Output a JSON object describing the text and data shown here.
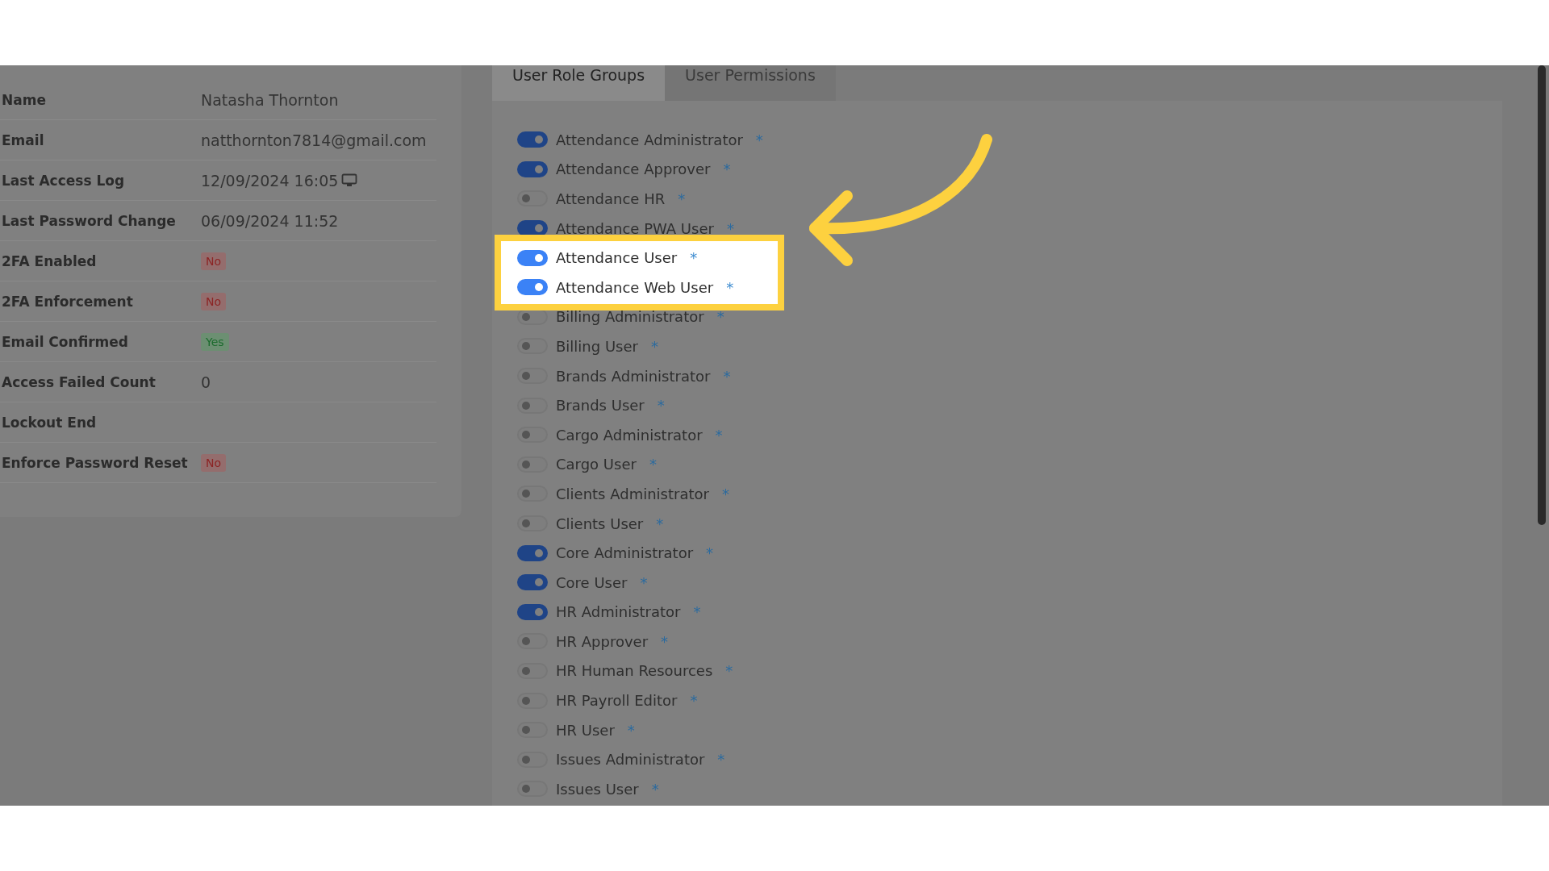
{
  "profile": [
    {
      "label": "Name",
      "value": "Natasha Thornton",
      "kind": "text"
    },
    {
      "label": "Email",
      "value": "natthornton7814@gmail.com",
      "kind": "text"
    },
    {
      "label": "Last Access Log",
      "value": "12/09/2024 16:05",
      "kind": "device"
    },
    {
      "label": "Last Password Change",
      "value": "06/09/2024 11:52",
      "kind": "text"
    },
    {
      "label": "2FA Enabled",
      "value": "No",
      "kind": "badge",
      "positive": false
    },
    {
      "label": "2FA Enforcement",
      "value": "No",
      "kind": "badge",
      "positive": false
    },
    {
      "label": "Email Confirmed",
      "value": "Yes",
      "kind": "badge",
      "positive": true
    },
    {
      "label": "Access Failed Count",
      "value": "0",
      "kind": "text"
    },
    {
      "label": "Lockout End",
      "kind": "text"
    },
    {
      "label": "Enforce Password Reset",
      "value": "No",
      "kind": "badge",
      "positive": false
    }
  ],
  "tabs": [
    {
      "label": "User Role Groups",
      "selected": true
    },
    {
      "label": "User Permissions",
      "selected": false
    }
  ],
  "roles": [
    {
      "name": "Attendance Administrator",
      "on": true,
      "highlighted": false,
      "mark": "*"
    },
    {
      "name": "Attendance Approver",
      "on": true,
      "highlighted": false,
      "mark": "*"
    },
    {
      "name": "Attendance HR",
      "on": false,
      "highlighted": false,
      "mark": "*"
    },
    {
      "name": "Attendance PWA User",
      "on": true,
      "highlighted": false,
      "mark": "*"
    },
    {
      "name": "Attendance User",
      "on": true,
      "highlighted": true,
      "mark": "*"
    },
    {
      "name": "Attendance Web User",
      "on": true,
      "highlighted": true,
      "mark": "*"
    },
    {
      "name": "Billing Administrator",
      "on": false,
      "highlighted": false,
      "mark": "*"
    },
    {
      "name": "Billing User",
      "on": false,
      "highlighted": false,
      "mark": "*"
    },
    {
      "name": "Brands Administrator",
      "on": false,
      "highlighted": false,
      "mark": "*"
    },
    {
      "name": "Brands User",
      "on": false,
      "highlighted": false,
      "mark": "*"
    },
    {
      "name": "Cargo Administrator",
      "on": false,
      "highlighted": false,
      "mark": "*"
    },
    {
      "name": "Cargo User",
      "on": false,
      "highlighted": false,
      "mark": "*"
    },
    {
      "name": "Clients Administrator",
      "on": false,
      "highlighted": false,
      "mark": "*"
    },
    {
      "name": "Clients User",
      "on": false,
      "highlighted": false,
      "mark": "*"
    },
    {
      "name": "Core Administrator",
      "on": true,
      "highlighted": false,
      "mark": "*"
    },
    {
      "name": "Core User",
      "on": true,
      "highlighted": false,
      "mark": "*"
    },
    {
      "name": "HR Administrator",
      "on": true,
      "highlighted": false,
      "mark": "*"
    },
    {
      "name": "HR Approver",
      "on": false,
      "highlighted": false,
      "mark": "*"
    },
    {
      "name": "HR Human Resources",
      "on": false,
      "highlighted": false,
      "mark": "*"
    },
    {
      "name": "HR Payroll Editor",
      "on": false,
      "highlighted": false,
      "mark": "*"
    },
    {
      "name": "HR User",
      "on": false,
      "highlighted": false,
      "mark": "*"
    },
    {
      "name": "Issues Administrator",
      "on": false,
      "highlighted": false,
      "mark": "*"
    },
    {
      "name": "Issues User",
      "on": false,
      "highlighted": false,
      "mark": "*"
    }
  ]
}
